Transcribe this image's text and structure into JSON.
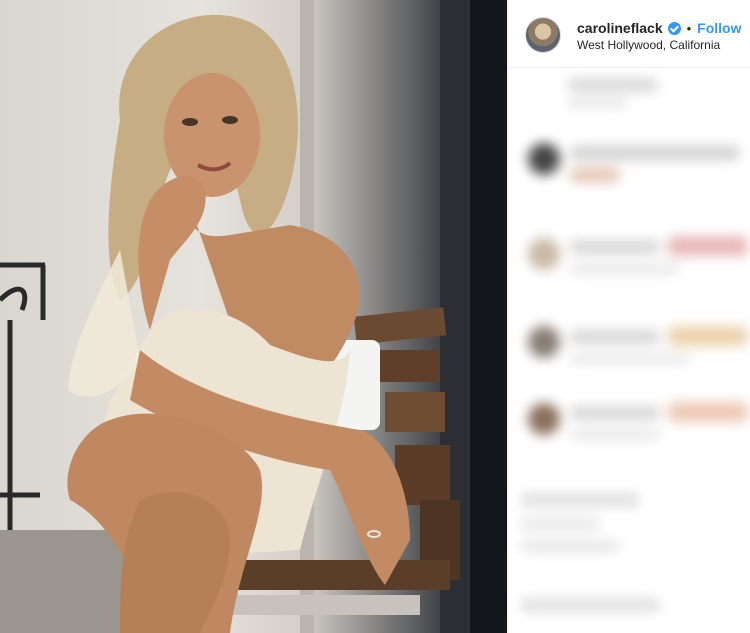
{
  "post": {
    "username": "carolineflack",
    "follow_label": "Follow",
    "separator": "•",
    "location": "West Hollywood, California"
  },
  "icons": {
    "verified": "verified-badge-icon"
  },
  "colors": {
    "link_blue": "#3897f0",
    "text": "#262626",
    "divider": "#efefef"
  }
}
